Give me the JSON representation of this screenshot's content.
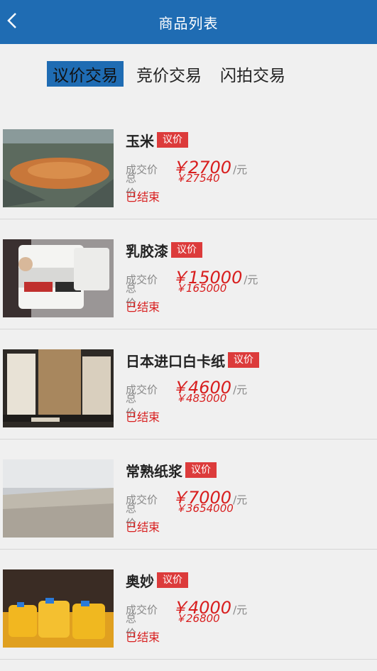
{
  "header": {
    "title": "商品列表"
  },
  "tabs": [
    {
      "label": "议价交易",
      "active": true
    },
    {
      "label": "竞价交易",
      "active": false
    },
    {
      "label": "闪拍交易",
      "active": false
    }
  ],
  "labels": {
    "deal_price": "成交价",
    "total_price": "总价:",
    "unit": "/元"
  },
  "items": [
    {
      "name": "玉米",
      "badge": "议价",
      "price": "￥2700",
      "unit": "/元",
      "total": "￥27540",
      "status": "已结束",
      "image": "corn-pile-image"
    },
    {
      "name": "乳胶漆",
      "badge": "议价",
      "price": "￥15000",
      "unit": "/元",
      "total": "￥165000",
      "status": "已结束",
      "image": "paint-bucket-image"
    },
    {
      "name": "日本进口白卡纸",
      "badge": "议价",
      "price": "￥4600",
      "unit": "/元",
      "total": "￥483000",
      "status": "已结束",
      "image": "paper-rolls-image"
    },
    {
      "name": "常熟纸浆",
      "badge": "议价",
      "price": "￥7000",
      "unit": "/元",
      "total": "￥3654000",
      "status": "已结束",
      "image": "paper-pulp-image"
    },
    {
      "name": "奥妙",
      "badge": "议价",
      "price": "￥4000",
      "unit": "/元",
      "total": "￥26800",
      "status": "已结束",
      "image": "detergent-bottles-image"
    }
  ],
  "colors": {
    "header": "#1f6cb3",
    "accent": "#d81e1e",
    "badge": "#dc3b3b"
  }
}
